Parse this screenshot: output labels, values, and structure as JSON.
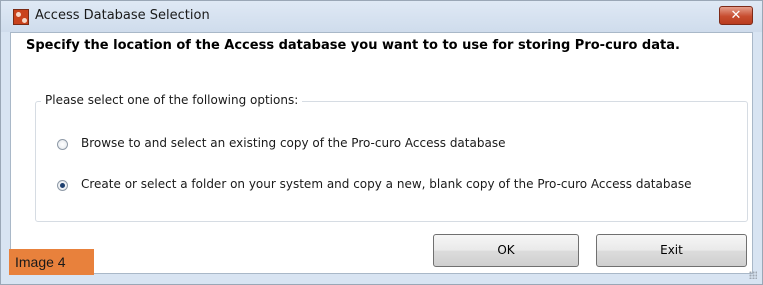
{
  "window": {
    "title": "Access Database Selection",
    "close_label": "✕"
  },
  "dialog": {
    "instruction": "Specify the location of the Access database you want to to use for storing Pro-curo data.",
    "group_label": "Please select one of the following options:",
    "options": [
      {
        "label": "Browse to and select an existing copy of the Pro-curo Access database",
        "selected": false
      },
      {
        "label": "Create or select a folder on your system and copy a new, blank copy of the Pro-curo Access database",
        "selected": true
      }
    ],
    "buttons": {
      "ok": "OK",
      "exit": "Exit"
    }
  },
  "overlay": {
    "tag": "Image 4"
  },
  "colors": {
    "title_bar": "#cfdcec",
    "close_button": "#c74c2f",
    "tag": "#e8813c"
  },
  "icons": {
    "app": "app-icon",
    "close": "close-icon",
    "grip": "resize-grip-icon"
  }
}
